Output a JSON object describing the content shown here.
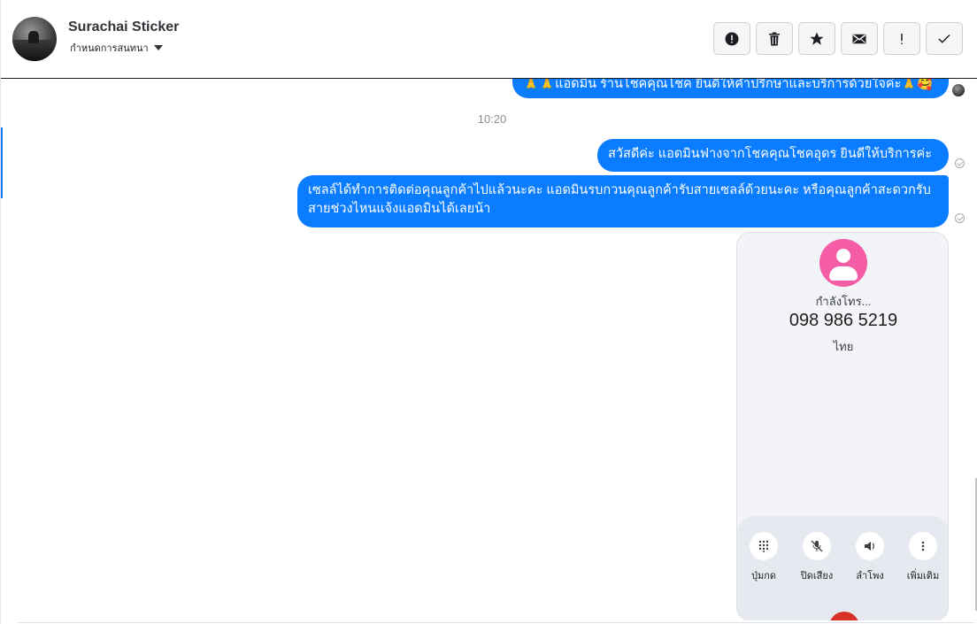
{
  "header": {
    "contact_name": "Surachai Sticker",
    "sub_label": "กำหนดการสนทนา",
    "actions": [
      {
        "name": "report",
        "icon": "alert-circle-icon",
        "label": "!"
      },
      {
        "name": "delete",
        "icon": "trash-icon"
      },
      {
        "name": "star",
        "icon": "star-icon"
      },
      {
        "name": "mark-unread",
        "icon": "envelope-icon"
      },
      {
        "name": "flag",
        "icon": "exclamation-icon",
        "label": "!"
      },
      {
        "name": "done",
        "icon": "check-icon"
      }
    ]
  },
  "messages": [
    {
      "id": "m0",
      "text": "🙏🙏แอดมิน ร้านโชคคุณโชค ยินดีให้คำปรึกษาและบริการด้วยใจค่ะ🙏🥰"
    },
    {
      "id": "time",
      "text": "10:20"
    },
    {
      "id": "m1",
      "text": "สวัสดีค่ะ แอดมินฟางจากโชคคุณโชคอุดร ยินดีให้บริการค่ะ"
    },
    {
      "id": "m2",
      "text": "เซลล์ได้ทำการติดต่อคุณลูกค้าไปแล้วนะคะ แอดมินรบกวนคุณลูกค้ารับสายเซลล์ด้วยนะคะ หรือคุณลูกค้าสะดวกรับสายช่วงไหนแจ้งแอดมินได้เลยน้า"
    }
  ],
  "call_screenshot": {
    "status": "กำลังโทร...",
    "number": "098 986 5219",
    "country": "ไทย",
    "controls": [
      "ปุ่มกด",
      "ปิดเสียง",
      "ลำโพง",
      "เพิ่มเติม"
    ]
  },
  "colors": {
    "bubble": "#0a7cff",
    "accent": "#1877f2",
    "call_avatar": "#f45ca6",
    "end_call": "#d93025"
  }
}
